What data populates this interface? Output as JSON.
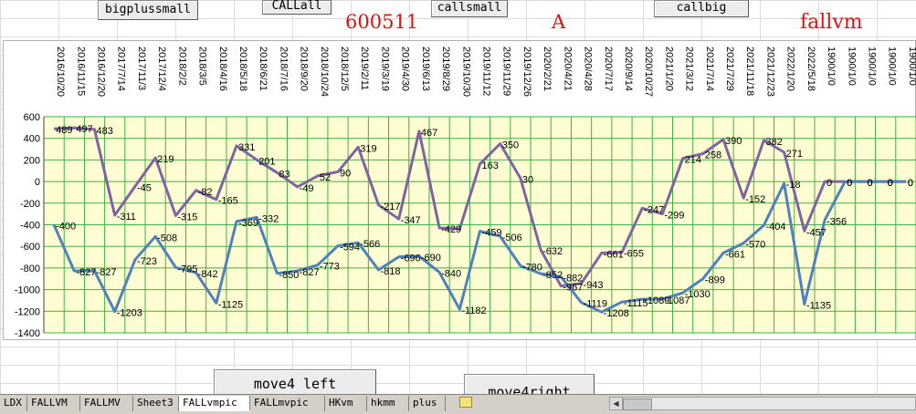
{
  "buttons": {
    "bigplussmall": "bigplussmall",
    "callall": "CALLall",
    "callsmall": "callsmall",
    "callbig": "callbig",
    "move_left": "move4 left",
    "move_right": "move4right"
  },
  "labels": {
    "code": "600511",
    "grade": "A",
    "mode": "fallvm"
  },
  "colors": {
    "plot_bg": "#fefed2",
    "grid": "#3cb043",
    "series_top": "#8064a2",
    "series_bottom": "#4f81bd",
    "label_red": "#e01010"
  },
  "tabs": [
    "LDX",
    "FALLVM",
    "FALLMV",
    "Sheet3",
    "FALLvmpic",
    "FALLmvpic",
    "HKvm",
    "hkmm",
    "plus"
  ],
  "active_tab": "FALLvmpic",
  "chart_data": {
    "type": "line",
    "categories": [
      "2016/10/20",
      "2016/11/15",
      "2016/12/20",
      "2017/7/14",
      "2017/11/3",
      "2017/12/4",
      "2018/2/2",
      "2018/3/5",
      "2018/4/16",
      "2018/5/18",
      "2018/6/21",
      "2018/7/16",
      "2018/9/20",
      "2018/10/24",
      "2018/12/5",
      "2019/2/11",
      "2019/3/19",
      "2019/4/30",
      "2019/6/13",
      "2019/8/29",
      "2019/10/30",
      "2019/11/12",
      "2019/11/29",
      "2019/12/26",
      "2020/2/21",
      "2020/4/21",
      "2020/4/28",
      "2020/7/17",
      "2020/9/14",
      "2020/10/27",
      "2021/1/20",
      "2021/3/12",
      "2021/7/14",
      "2021/7/29",
      "2021/11/18",
      "2021/12/23",
      "2022/1/20",
      "2022/5/18",
      "1900/1/0",
      "1900/1/0",
      "1900/1/0",
      "1900/1/0",
      "1900/1/0"
    ],
    "series": [
      {
        "values": [
          489,
          497,
          483,
          -311,
          -45,
          219,
          -315,
          -82,
          -165,
          331,
          201,
          83,
          -49,
          52,
          90,
          319,
          -217,
          -347,
          467,
          -429,
          -440,
          163,
          350,
          30,
          -632,
          -967,
          -943,
          -661,
          -655,
          -247,
          -299,
          214,
          258,
          390,
          -152,
          382,
          271,
          -457,
          0,
          0,
          0,
          0,
          0
        ],
        "labels": [
          "489",
          "497",
          "483",
          "-311",
          "-45",
          "219",
          "-315",
          "-82",
          "-165",
          "331",
          "201",
          "83",
          "-49",
          "52",
          "90",
          "319",
          "-217",
          "-347",
          "467",
          "-429",
          "",
          "163",
          "350",
          "30",
          "-632",
          "-967",
          "-943",
          "-661",
          "-655",
          "-247",
          "-299",
          "214",
          "258",
          "390",
          "-152",
          "382",
          "271",
          "-457",
          "0",
          "0",
          "0",
          "0",
          "0"
        ]
      },
      {
        "values": [
          -400,
          -827,
          -827,
          -1203,
          -723,
          -508,
          -795,
          -842,
          -1125,
          -369,
          -332,
          -850,
          -827,
          -773,
          -594,
          -566,
          -818,
          -696,
          -690,
          -840,
          -1182,
          -459,
          -506,
          -780,
          -852,
          -882,
          -1119,
          -1208,
          -1115,
          -1089,
          -1087,
          -1030,
          -899,
          -661,
          -570,
          -404,
          -18,
          -1135,
          -356,
          0,
          0,
          0,
          0
        ],
        "labels": [
          "-400",
          "-827",
          "-827",
          "-1203",
          "-723",
          "-508",
          "-795",
          "-842",
          "-1125",
          "-369",
          "-332",
          "-850",
          "-827",
          "-773",
          "-594",
          "-566",
          "-818",
          "-696",
          "-690",
          "-840",
          "-1182",
          "-459",
          "-506",
          "-780",
          "-852",
          "-882",
          "-1119",
          "-1208",
          "-1115",
          "-1089",
          "-1087",
          "-1030",
          "-899",
          "-661",
          "-570",
          "-404",
          "-18",
          "-1135",
          "-356",
          "0",
          "0",
          "0",
          "0"
        ]
      }
    ],
    "y_ticks": [
      "600",
      "400",
      "200",
      "0",
      "-200",
      "-400",
      "-600",
      "-800",
      "-1000",
      "-1200",
      "-1400"
    ],
    "ylim": [
      -1400,
      600
    ],
    "grid": true
  }
}
